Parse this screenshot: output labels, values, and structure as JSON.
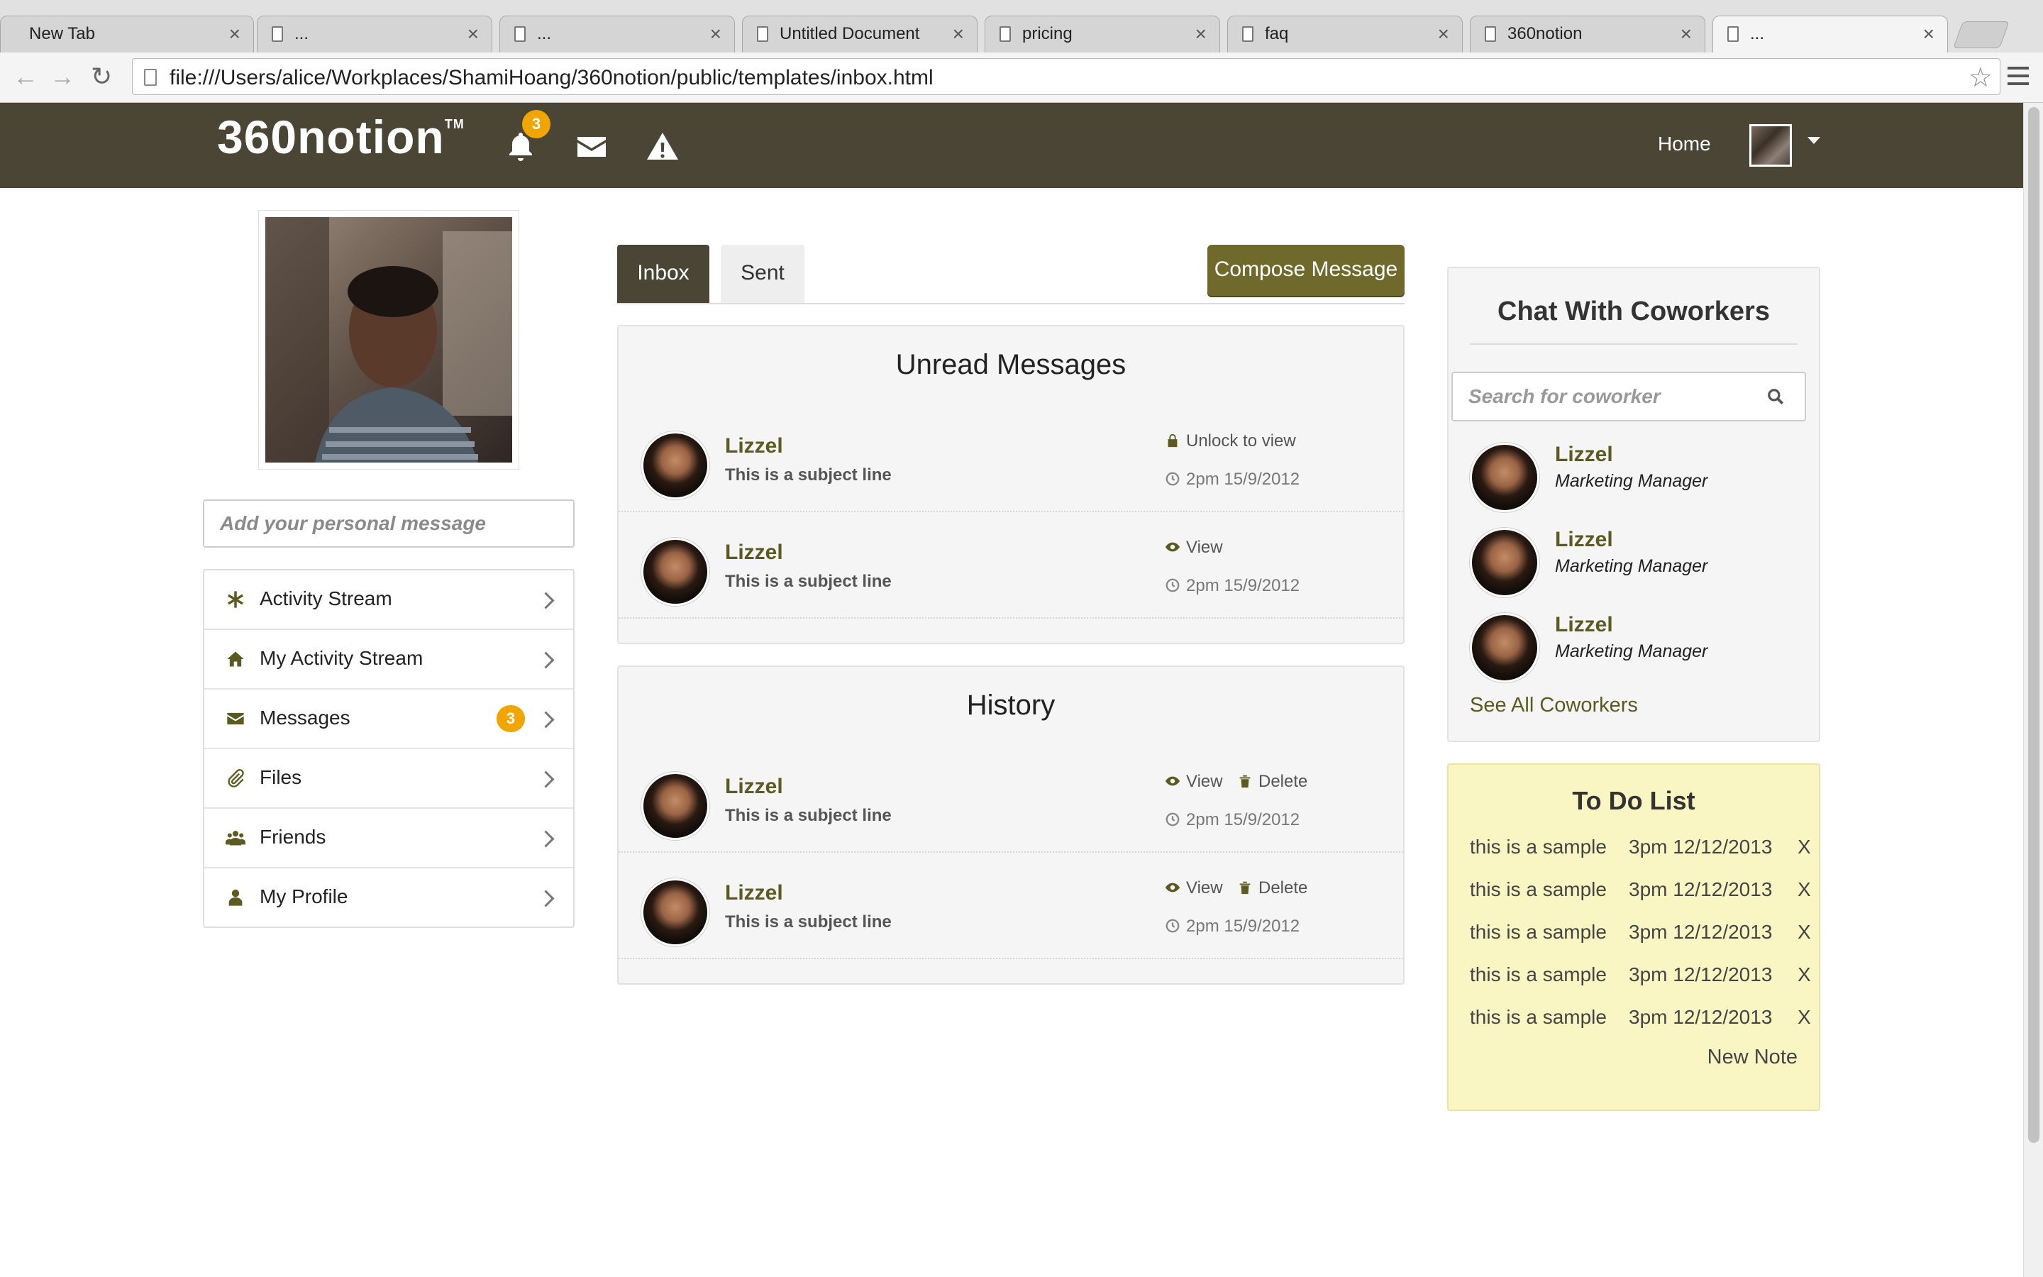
{
  "browser": {
    "tabs": [
      {
        "label": "New Tab"
      },
      {
        "label": "..."
      },
      {
        "label": "..."
      },
      {
        "label": "Untitled Document"
      },
      {
        "label": "pricing"
      },
      {
        "label": "faq"
      },
      {
        "label": "360notion"
      },
      {
        "label": "..."
      }
    ],
    "close_glyph": "×",
    "url": "file:///Users/alice/Workplaces/ShamiHoang/360notion/public/templates/inbox.html"
  },
  "header": {
    "logo": "360notion",
    "logo_tm": "TM",
    "notifications_count": "3",
    "home_label": "Home"
  },
  "sidebar": {
    "personal_message_placeholder": "Add your personal message",
    "items": [
      {
        "label": "Activity Stream",
        "icon": "asterisk-icon"
      },
      {
        "label": "My Activity Stream",
        "icon": "home-icon"
      },
      {
        "label": "Messages",
        "icon": "envelope-icon",
        "badge": "3"
      },
      {
        "label": "Files",
        "icon": "paperclip-icon"
      },
      {
        "label": "Friends",
        "icon": "group-icon"
      },
      {
        "label": "My Profile",
        "icon": "user-icon"
      }
    ]
  },
  "inbox": {
    "tabs": [
      {
        "label": "Inbox"
      },
      {
        "label": "Sent"
      }
    ],
    "compose_label": "Compose Message",
    "unread": {
      "title": "Unread Messages",
      "messages": [
        {
          "sender": "Lizzel",
          "subject": "This is a subject line",
          "action": "Unlock to view",
          "time": "2pm 15/9/2012"
        },
        {
          "sender": "Lizzel",
          "subject": "This is a subject line",
          "action": "View",
          "time": "2pm 15/9/2012"
        }
      ]
    },
    "history": {
      "title": "History",
      "messages": [
        {
          "sender": "Lizzel",
          "subject": "This is a subject line",
          "action": "View",
          "delete": "Delete",
          "time": "2pm 15/9/2012"
        },
        {
          "sender": "Lizzel",
          "subject": "This is a subject line",
          "action": "View",
          "delete": "Delete",
          "time": "2pm 15/9/2012"
        }
      ]
    }
  },
  "chat": {
    "title": "Chat With Coworkers",
    "search_placeholder": "Search for coworker",
    "coworkers": [
      {
        "name": "Lizzel",
        "role": "Marketing Manager"
      },
      {
        "name": "Lizzel",
        "role": "Marketing Manager"
      },
      {
        "name": "Lizzel",
        "role": "Marketing Manager"
      }
    ],
    "see_all": "See All Coworkers"
  },
  "todo": {
    "title": "To Do List",
    "items": [
      {
        "text": "this is a sample",
        "when": "3pm 12/12/2013",
        "remove": "X"
      },
      {
        "text": "this is a sample",
        "when": "3pm 12/12/2013",
        "remove": "X"
      },
      {
        "text": "this is a sample",
        "when": "3pm 12/12/2013",
        "remove": "X"
      },
      {
        "text": "this is a sample",
        "when": "3pm 12/12/2013",
        "remove": "X"
      },
      {
        "text": "this is a sample",
        "when": "3pm 12/12/2013",
        "remove": "X"
      }
    ],
    "new_note": "New Note"
  },
  "colors": {
    "header_bg": "#4a4535",
    "accent_olive": "#6f6a2c",
    "link_olive": "#5b5a20",
    "badge_orange": "#f0a500",
    "todo_bg": "#faf6c3"
  }
}
